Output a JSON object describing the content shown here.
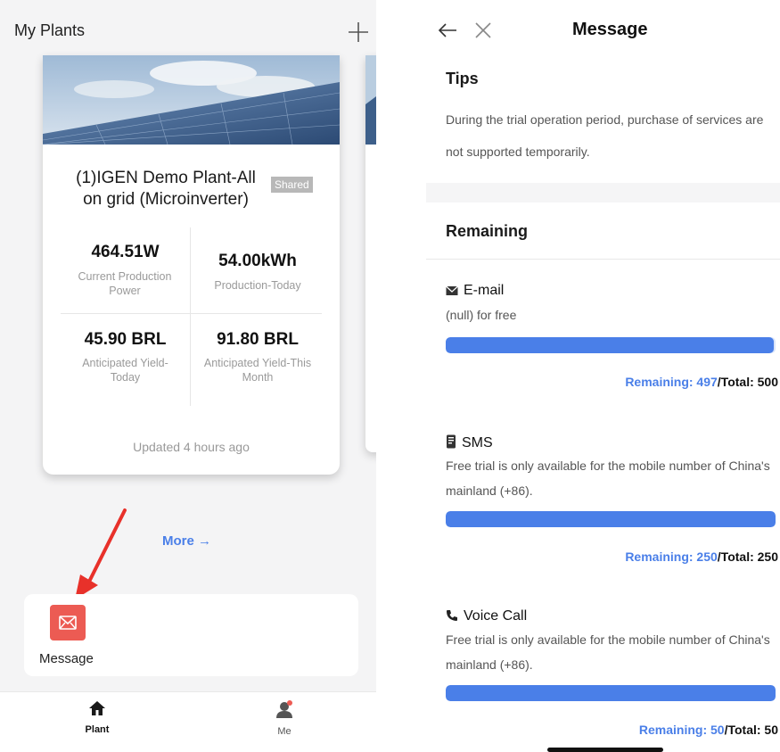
{
  "left": {
    "title": "My Plants",
    "add_icon": "plus-icon",
    "plant": {
      "name": "(1)IGEN Demo Plant-All on grid (Microinverter)",
      "badge": "Shared",
      "metrics": [
        {
          "value": "464.51W",
          "label": "Current Production Power"
        },
        {
          "value": "54.00kWh",
          "label": "Production-Today"
        },
        {
          "value": "45.90 BRL",
          "label": "Anticipated Yield-Today"
        },
        {
          "value": "91.80 BRL",
          "label": "Anticipated Yield-This Month"
        }
      ],
      "updated": "Updated 4 hours ago"
    },
    "more_label": "More →",
    "message_tile": {
      "label": "Message",
      "icon": "envelope-icon"
    },
    "tabs": [
      {
        "label": "Plant",
        "icon": "home-icon",
        "active": true
      },
      {
        "label": "Me",
        "icon": "user-icon",
        "active": false
      }
    ]
  },
  "right": {
    "nav_title": "Message",
    "back_icon": "arrow-left-icon",
    "close_icon": "close-icon",
    "tips": {
      "title": "Tips",
      "text": "During the trial operation period, purchase of services are not supported temporarily."
    },
    "remaining_title": "Remaining",
    "services": [
      {
        "name": "E-mail",
        "icon": "mail-icon",
        "desc": "(null) for free",
        "remaining_label": "Remaining: 497",
        "total_label": "/Total: 500",
        "fraction": 0.994
      },
      {
        "name": "SMS",
        "icon": "phone-message-icon",
        "desc": "Free trial is only available for the mobile number of China's mainland (+86).",
        "remaining_label": "Remaining: 250",
        "total_label": "/Total: 250",
        "fraction": 1.0
      },
      {
        "name": "Voice Call",
        "icon": "phone-icon",
        "desc": "Free trial is only available for the mobile number of China's mainland (+86).",
        "remaining_label": "Remaining: 50",
        "total_label": "/Total: 50",
        "fraction": 1.0
      }
    ]
  },
  "colors": {
    "accent": "#4a7fe8",
    "message_icon_bg": "#ec5b53",
    "arrow": "#e8312a"
  }
}
